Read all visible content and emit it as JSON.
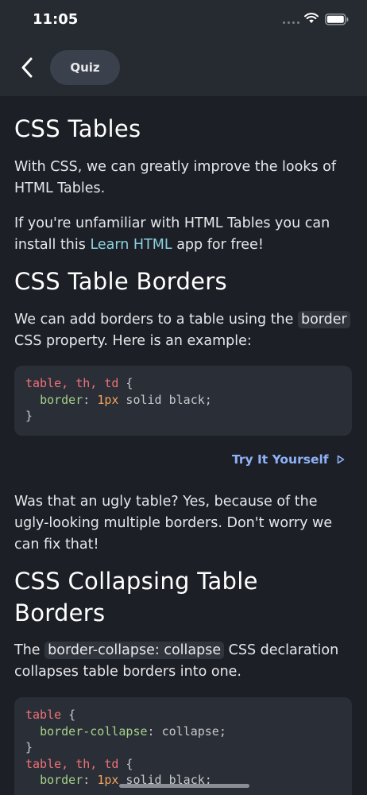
{
  "status_bar": {
    "time": "11:05"
  },
  "header": {
    "quiz_label": "Quiz"
  },
  "lesson": {
    "title": "CSS Tables",
    "intro": "With CSS, we can greatly improve the looks of HTML Tables.",
    "unfamiliar_prefix": "If you're unfamiliar with HTML Tables you can install this ",
    "learn_html_link": "Learn HTML",
    "unfamiliar_suffix": " app for free!",
    "borders_heading": "CSS Table Borders",
    "borders_text_prefix": "We can add borders to a table using the ",
    "borders_inline_code": "border",
    "borders_text_suffix": " CSS property. Here is an example:",
    "code1": {
      "line1_selector": "table, th, td",
      "line1_brace": " {",
      "line2_prop": "border",
      "line2_colon": ": ",
      "line2_num": "1px",
      "line2_rest": " solid black;",
      "line3": "}"
    },
    "try_label": "Try It Yourself",
    "ugly_text": "Was that an ugly table? Yes, because of the ugly-looking multiple borders. Don't worry we can fix that!",
    "collapse_heading_line1": "CSS Collapsing Table",
    "collapse_heading_line2": "Borders",
    "collapse_text_prefix": "The ",
    "collapse_inline_code": "border-collapse: collapse",
    "collapse_text_suffix": " CSS declaration collapses table borders into one.",
    "code2": {
      "l1_selector": "table",
      "l1_brace": " {",
      "l2_prop": "border-collapse",
      "l2_colon": ": ",
      "l2_val": "collapse;",
      "l3": "}",
      "l4_selector": "table, th, td",
      "l4_brace": " {",
      "l5_prop": "border",
      "l5_colon": ": ",
      "l5_num": "1px",
      "l5_rest": " solid black;"
    }
  },
  "colors": {
    "background": "#1c1f26",
    "header_bg": "#262a31",
    "link": "#8dd0e0",
    "try_button": "#8fb2f7",
    "code_keyword": "#f07178",
    "code_property": "#a6d18a",
    "code_number": "#f5a35c"
  },
  "icons": [
    "back-chevron-icon",
    "wifi-icon",
    "battery-icon",
    "play-triangle-icon"
  ]
}
